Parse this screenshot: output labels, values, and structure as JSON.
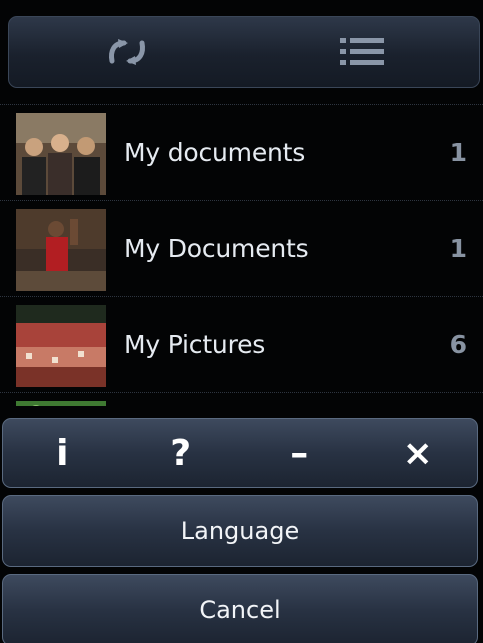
{
  "toolbar": {
    "sync_icon": "sync-arrows-icon",
    "list_icon": "list-view-icon"
  },
  "folders": [
    {
      "label": "My documents",
      "count": "1"
    },
    {
      "label": "My Documents",
      "count": "1"
    },
    {
      "label": "My Pictures",
      "count": "6"
    }
  ],
  "actions": {
    "info": "i",
    "help": "?",
    "minimize": "–",
    "close": "×"
  },
  "buttons": {
    "language": "Language",
    "cancel": "Cancel"
  },
  "colors": {
    "background": "#030405",
    "button_border": "#5a6a80",
    "count_text": "#8893a2"
  }
}
